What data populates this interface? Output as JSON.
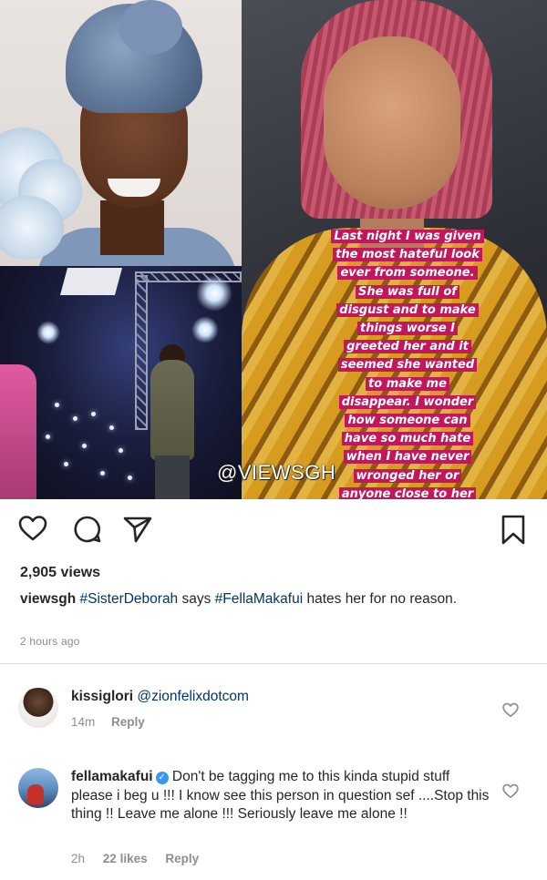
{
  "story": {
    "caption_lines": [
      "Last night I was given",
      "the most hateful look",
      "ever from someone.",
      "She was full of",
      "disgust and to make",
      "things worse I",
      "greeted her and it",
      "seemed she wanted",
      "to make me",
      "disappear. I wonder",
      "how someone can",
      "have so much hate",
      "when I have never",
      "wronged her or",
      "anyone close to her"
    ],
    "highlight_color": "#c2185b"
  },
  "watermark": "@VIEWSGH",
  "actions": {
    "like_icon": "heart-icon",
    "comment_icon": "comment-bubble-icon",
    "share_icon": "send-paper-plane-icon",
    "save_icon": "bookmark-icon"
  },
  "post": {
    "views": "2,905 views",
    "username": "viewsgh",
    "caption_tag1": "#SisterDeborah",
    "caption_mid": " says ",
    "caption_tag2": "#FellaMakafui",
    "caption_rest": " hates her for no reason.",
    "time_ago": "2 hours ago",
    "link_color": "#003569"
  },
  "comments": [
    {
      "username": "kissiglori",
      "mention": "@zionfelixdotcom",
      "text": "",
      "time": "14m",
      "likes": "",
      "reply_label": "Reply",
      "like_icon": "heart-outline-icon"
    },
    {
      "username": "fellamakafui",
      "verified": "✓",
      "mention": "",
      "text": "Don't be tagging me to this kinda stupid stuff please i beg u !!! I know see this person in question sef ....Stop this thing !! Leave me alone !!! Seriously leave me alone !!",
      "time": "2h",
      "likes": "22 likes",
      "reply_label": "Reply",
      "like_icon": "heart-outline-icon"
    }
  ]
}
